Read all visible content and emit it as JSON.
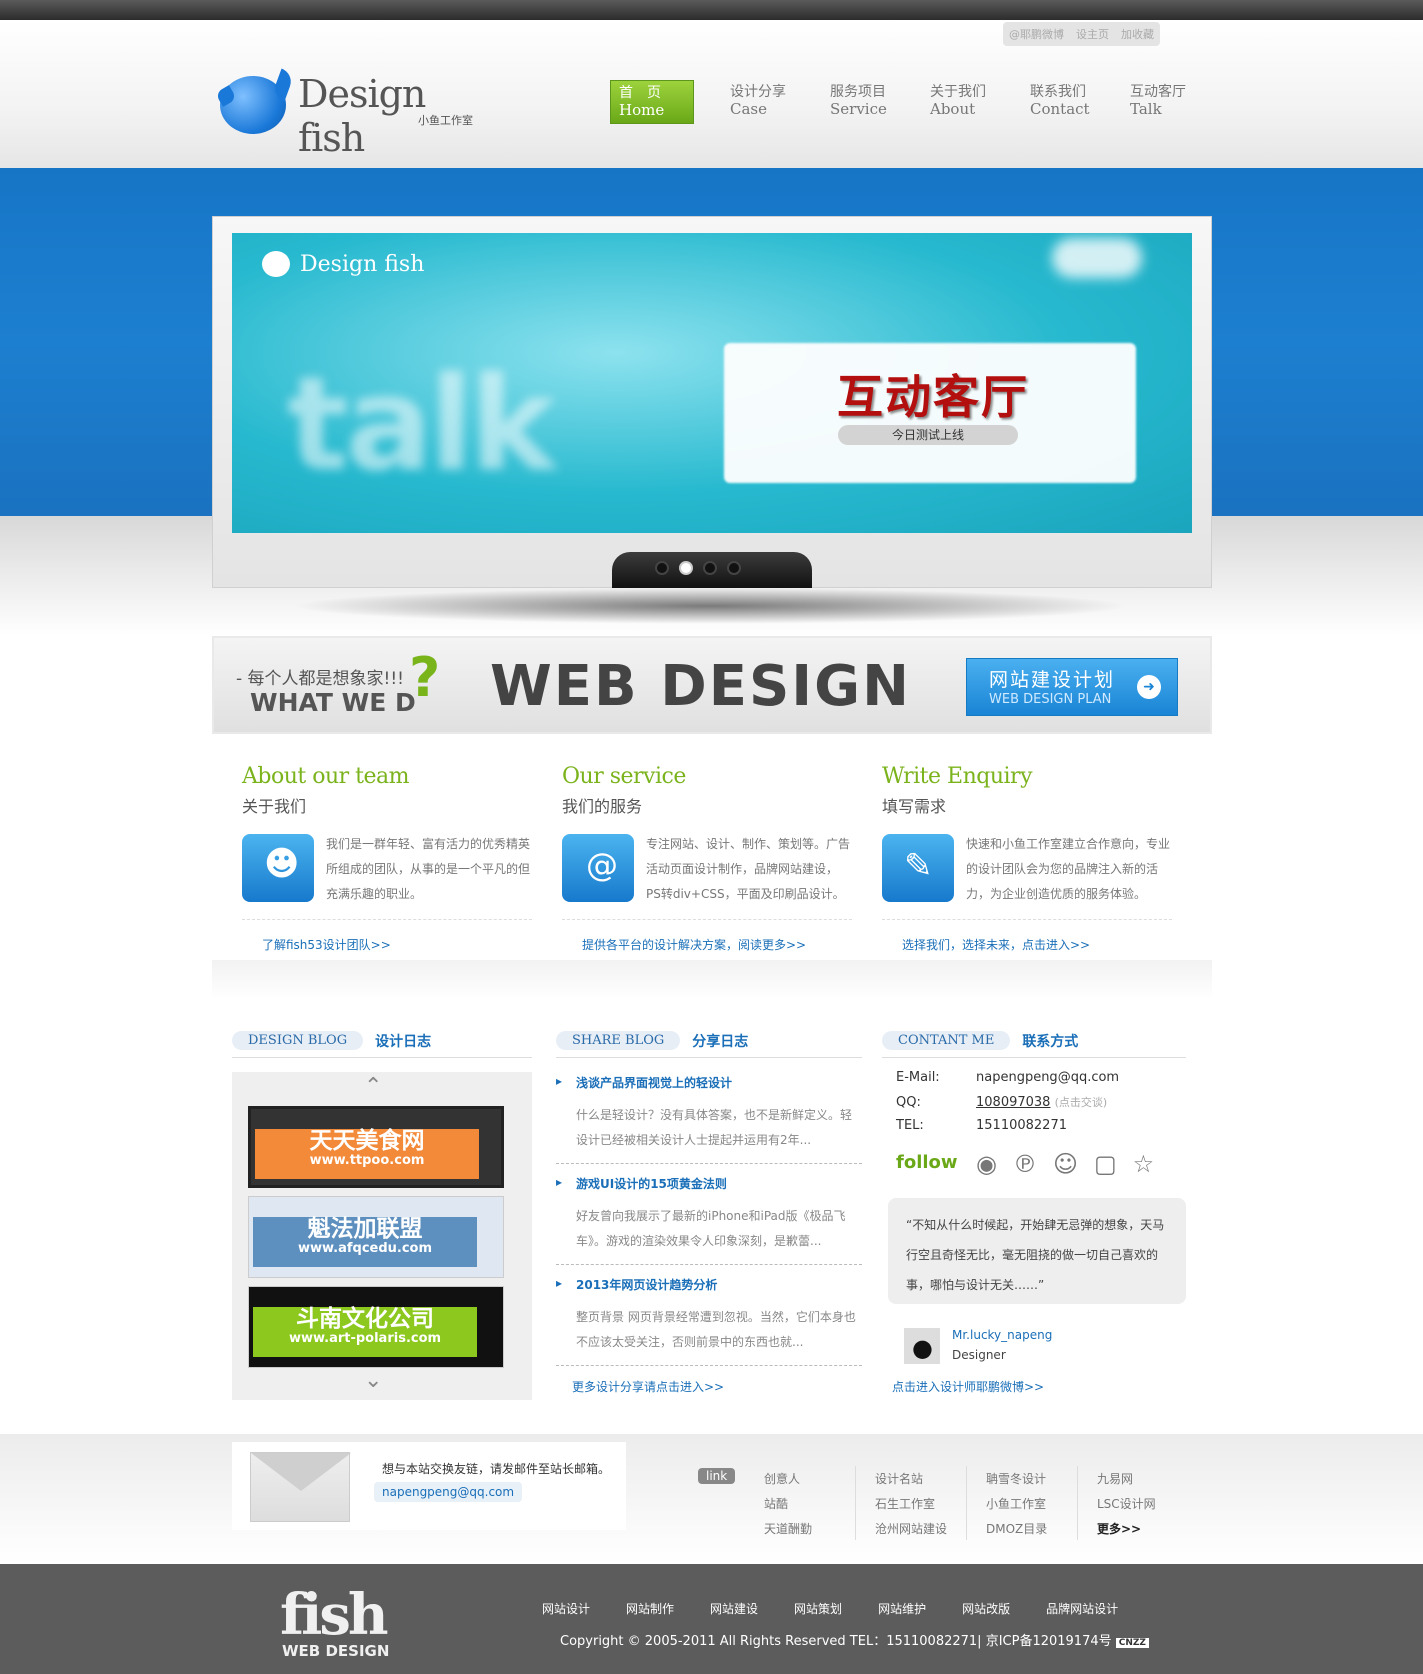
{
  "utility": {
    "weibo": "@耶鹏微博",
    "homepage": "设主页",
    "favorite": "加收藏"
  },
  "logo": {
    "name": "Design fish",
    "sub": "小鱼工作室"
  },
  "nav": [
    {
      "zh": "首　页",
      "en": "Home"
    },
    {
      "zh": "设计分享",
      "en": "Case"
    },
    {
      "zh": "服务项目",
      "en": "Service"
    },
    {
      "zh": "关于我们",
      "en": "About"
    },
    {
      "zh": "联系我们",
      "en": "Contact"
    },
    {
      "zh": "互动客厅",
      "en": "Talk"
    }
  ],
  "slider": {
    "brand": "Design fish",
    "bg_word": "talk",
    "headline": "互动客厅",
    "subline": "今日测试上线"
  },
  "banner": {
    "line1": "- 每个人都是想象家!!!",
    "line2": "WHAT WE D",
    "title": "WEB DESIGN",
    "button_zh": "网站建设计划",
    "button_en": "WEB DESIGN PLAN"
  },
  "columns": [
    {
      "en": "About our team",
      "zh": "关于我们",
      "text": "我们是一群年轻、富有活力的优秀精英所组成的团队，从事的是一个平凡的但充满乐趣的职业。",
      "more": "了解fish53设计团队>>"
    },
    {
      "en": "Our service",
      "zh": "我们的服务",
      "text": "专注网站、设计、制作、策划等。广告活动页面设计制作，品牌网站建设，PS转div+CSS，平面及印刷品设计。",
      "more": "提供各平台的设计解决方案，阅读更多>>"
    },
    {
      "en": "Write Enquiry",
      "zh": "填写需求",
      "text": "快速和小鱼工作室建立合作意向，专业的设计团队会为您的品牌注入新的活力，为企业创造优质的服务体验。",
      "more": "选择我们，选择未来，点击进入>>"
    }
  ],
  "blog": {
    "tag": "DESIGN BLOG",
    "zh": "设计日志",
    "items": [
      {
        "title": "天天美食网",
        "url": "www.ttpoo.com"
      },
      {
        "title": "魁法加联盟",
        "url": "www.afqcedu.com"
      },
      {
        "title": "斗南文化公司",
        "url": "www.art-polaris.com"
      }
    ]
  },
  "share": {
    "tag": "SHARE BLOG",
    "zh": "分享日志",
    "articles": [
      {
        "title": "浅谈产品界面视觉上的轻设计",
        "desc": "什么是轻设计？没有具体答案，也不是新鲜定义。轻设计已经被相关设计人士提起并运用有2年..."
      },
      {
        "title": "游戏UI设计的15项黄金法则",
        "desc": "好友曾向我展示了最新的iPhone和iPad版《极品飞车》。游戏的渲染效果令人印象深刻，是歉蕾..."
      },
      {
        "title": "2013年网页设计趋势分析",
        "desc": "整页背景 网页背景经常遭到忽视。当然，它们本身也不应该太受关注，否则前景中的东西也就..."
      }
    ],
    "more": "更多设计分享请点击进入>>"
  },
  "contact": {
    "tag": "CONTANT ME",
    "zh": "联系方式",
    "email_k": "E-Mail:",
    "email": "napengpeng@qq.com",
    "qq_k": "QQ:",
    "qq": "108097038",
    "qq_note": "(点击交谈)",
    "tel_k": "TEL:",
    "tel": "15110082271",
    "follow": "follow",
    "quote": "“不知从什么时候起，开始肆无忌弹的想象，天马行空且奇怪无比，毫无阻挠的做一切自己喜欢的事，哪怕与设计无关……”",
    "author": "Mr.lucky_napeng",
    "role": "Designer",
    "more": "点击进入设计师耶鹏微博>>"
  },
  "footer": {
    "mail_text": "想与本站交换友链，请发邮件至站长邮箱。",
    "mail": "napengpeng@qq.com",
    "link_tag": "link",
    "links": [
      [
        "创意人",
        "站酷",
        "天道酬勤"
      ],
      [
        "设计名站",
        "石生工作室",
        "沧州网站建设"
      ],
      [
        "聃雪冬设计",
        "小鱼工作室",
        "DMOZ目录"
      ],
      [
        "九易网",
        "LSC设计网",
        "更多>>"
      ]
    ]
  },
  "bottom": {
    "logo": "fish",
    "logo_sub": "WEB DESIGN",
    "nav": [
      "网站设计",
      "网站制作",
      "网站建设",
      "网站策划",
      "网站维护",
      "网站改版",
      "品牌网站设计"
    ],
    "copyright": "Copyright © 2005-2011 All Rights Reserved TEL：15110082271| 京ICP备12019174号",
    "badge": "CNZZ"
  }
}
